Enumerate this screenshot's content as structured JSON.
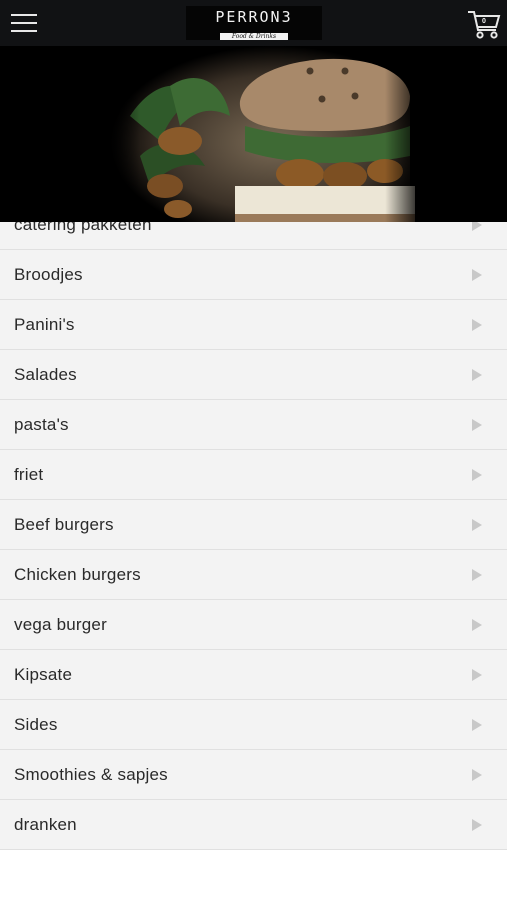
{
  "header": {
    "logo_text": "PERRON3",
    "logo_tagline": "Food & Drinks",
    "cart_count": "0",
    "menu_icon": "hamburger-icon",
    "cart_icon": "shopping-cart-icon"
  },
  "hero": {
    "image": "sandwich-with-walnuts-and-arugula"
  },
  "categories": [
    {
      "label": "catering pakketen"
    },
    {
      "label": "Broodjes"
    },
    {
      "label": "Panini's"
    },
    {
      "label": "Salades"
    },
    {
      "label": "pasta's"
    },
    {
      "label": "friet"
    },
    {
      "label": "Beef burgers"
    },
    {
      "label": "Chicken burgers"
    },
    {
      "label": "vega burger"
    },
    {
      "label": "Kipsate"
    },
    {
      "label": "Sides"
    },
    {
      "label": "Smoothies & sapjes"
    },
    {
      "label": "dranken"
    }
  ],
  "colors": {
    "topbar": "#111214",
    "row_background": "#f3f3f3",
    "row_divider": "#e0e0e0",
    "arrow": "#c8c8c8",
    "text": "#2a2a2a"
  }
}
